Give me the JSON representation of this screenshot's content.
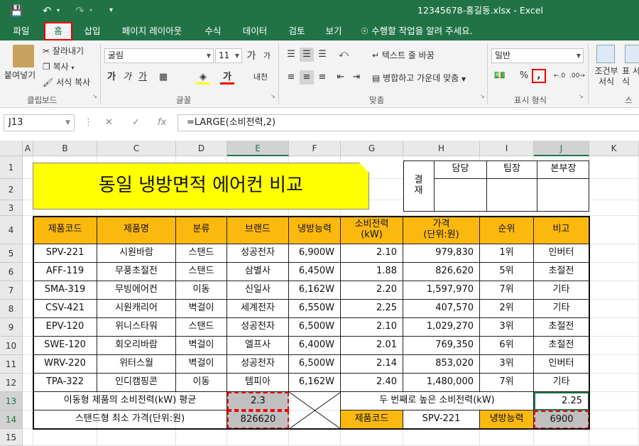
{
  "window": {
    "title": "12345678-홍길동.xlsx - Excel"
  },
  "menu": [
    "파일",
    "홈",
    "삽입",
    "페이지 레이아웃",
    "수식",
    "데이터",
    "검토",
    "보기"
  ],
  "tell_me": "수행할 작업을 알려 주세요.",
  "ribbon": {
    "clipboard": {
      "paste": "붙여넣기",
      "cut": "잘라내기",
      "copy": "복사",
      "format_painter": "서식 복사",
      "label": "클립보드"
    },
    "font": {
      "name": "굴림",
      "size": "11",
      "label": "글꼴",
      "bold": "가",
      "italic": "가",
      "underline": "가",
      "grow": "가",
      "shrink": "가",
      "phonetic": "내천"
    },
    "alignment": {
      "wrap": "텍스트 줄 바꿈",
      "merge": "병합하고 가운데 맞춤",
      "label": "맞춤"
    },
    "number": {
      "format": "일반",
      "label": "표시 형식",
      "percent": "%",
      "comma": ","
    },
    "styles": {
      "conditional": "조건부 서식",
      "table": "표 서식",
      "label": "스"
    }
  },
  "formula_bar": {
    "name_box": "J13",
    "formula": "=LARGE(소비전력,2)"
  },
  "columns": [
    "A",
    "B",
    "C",
    "D",
    "E",
    "F",
    "G",
    "H",
    "I",
    "J",
    "K"
  ],
  "rows": [
    "1",
    "2",
    "3",
    "4",
    "5",
    "6",
    "7",
    "8",
    "9",
    "10",
    "11",
    "12",
    "13",
    "14",
    "15"
  ],
  "sheet": {
    "title": "동일 냉방면적 에어컨 비교",
    "approval": {
      "label": "결재",
      "cols": [
        "담당",
        "팀장",
        "본부장"
      ]
    },
    "headers": [
      "제품코드",
      "제품명",
      "분류",
      "브랜드",
      "냉방능력",
      "소비전력\n(kW)",
      "가격\n(단위:원)",
      "순위",
      "비고"
    ],
    "data": [
      [
        "SPV-221",
        "시원바람",
        "스탠드",
        "성공전자",
        "6,900W",
        "2.10",
        "979,830",
        "1위",
        "인버터"
      ],
      [
        "AFF-119",
        "무풍초절전",
        "스탠드",
        "삼별사",
        "6,450W",
        "1.88",
        "826,620",
        "5위",
        "초절전"
      ],
      [
        "SMA-319",
        "무빙에어컨",
        "이동",
        "신일사",
        "6,162W",
        "2.20",
        "1,597,970",
        "7위",
        "기타"
      ],
      [
        "CSV-421",
        "시원캐리어",
        "벽걸이",
        "세계전자",
        "6,550W",
        "2.25",
        "407,570",
        "2위",
        "기타"
      ],
      [
        "EPV-120",
        "위니스타워",
        "스탠드",
        "성공전자",
        "6,500W",
        "2.10",
        "1,029,270",
        "3위",
        "초절전"
      ],
      [
        "SWE-120",
        "회오리바람",
        "벽걸이",
        "엘프사",
        "6,400W",
        "2.01",
        "769,350",
        "6위",
        "초절전"
      ],
      [
        "WRV-220",
        "위터스월",
        "벽걸이",
        "성공전자",
        "6,500W",
        "2.14",
        "853,020",
        "3위",
        "인버터"
      ],
      [
        "TPA-322",
        "인디캠핑콘",
        "이동",
        "템피아",
        "6,162W",
        "2.40",
        "1,480,000",
        "7위",
        "기타"
      ]
    ],
    "summary": {
      "avg_label": "이동형 제품의 소비전력(kW) 평균",
      "avg_value": "2.3",
      "min_label": "스탠드형 최소 가격(단위:원)",
      "min_value": "826620",
      "second_label": "두 번째로 높은 소비전력(kW)",
      "second_value": "2.25",
      "code_label": "제품코드",
      "code_value": "SPV-221",
      "cool_label": "냉방능력",
      "cool_value": "6900"
    }
  },
  "colors": {
    "excel_green": "#217346",
    "header_orange": "#fbb80f",
    "title_yellow": "#ffff00",
    "highlight_red": "#e00000",
    "summary_gray": "#c0c0c0"
  }
}
